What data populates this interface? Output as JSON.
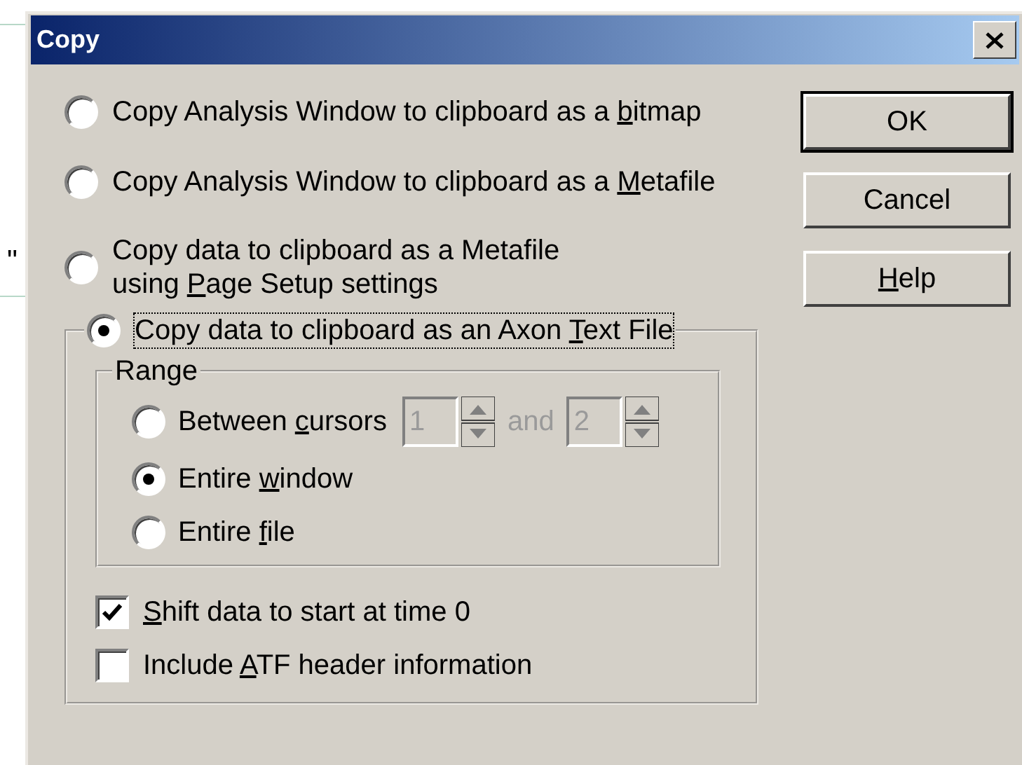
{
  "background": {
    "text_fragment": "\""
  },
  "window": {
    "title": "Copy"
  },
  "options": [
    {
      "selected": false,
      "focused": false,
      "label": [
        {
          "text": "Copy Analysis Window to clipboard as a ",
          "access_key": false
        },
        {
          "text": "b",
          "access_key": true
        },
        {
          "text": "itmap",
          "access_key": false
        }
      ]
    },
    {
      "selected": false,
      "focused": false,
      "label": [
        {
          "text": "Copy Analysis Window to clipboard as a ",
          "access_key": false
        },
        {
          "text": "M",
          "access_key": true
        },
        {
          "text": "etafile",
          "access_key": false
        }
      ]
    },
    {
      "selected": false,
      "focused": false,
      "label": [
        {
          "text": "Copy data to clipboard as a Metafile\nusing ",
          "access_key": false
        },
        {
          "text": "P",
          "access_key": true
        },
        {
          "text": "age Setup settings",
          "access_key": false
        }
      ]
    },
    {
      "selected": true,
      "focused": true,
      "label": [
        {
          "text": "Copy data to clipboard as an Axon ",
          "access_key": false
        },
        {
          "text": "T",
          "access_key": true
        },
        {
          "text": "ext File",
          "access_key": false
        }
      ]
    }
  ],
  "range": {
    "title": "Range",
    "options": [
      {
        "kind": "cursors",
        "selected": false,
        "disabled": true,
        "label": [
          {
            "text": "Between ",
            "access_key": false
          },
          {
            "text": "c",
            "access_key": true
          },
          {
            "text": "ursors",
            "access_key": false
          }
        ],
        "from": "1",
        "joiner": "and",
        "to": "2"
      },
      {
        "kind": "plain",
        "selected": true,
        "label": [
          {
            "text": "Entire ",
            "access_key": false
          },
          {
            "text": "w",
            "access_key": true
          },
          {
            "text": "indow",
            "access_key": false
          }
        ]
      },
      {
        "kind": "plain",
        "selected": false,
        "label": [
          {
            "text": "Entire ",
            "access_key": false
          },
          {
            "text": "f",
            "access_key": true
          },
          {
            "text": "ile",
            "access_key": false
          }
        ]
      }
    ]
  },
  "checkboxes": [
    {
      "checked": true,
      "label": [
        {
          "text": "S",
          "access_key": true
        },
        {
          "text": "hift data to start at time 0",
          "access_key": false
        }
      ]
    },
    {
      "checked": false,
      "label": [
        {
          "text": "Include ",
          "access_key": false
        },
        {
          "text": "A",
          "access_key": true
        },
        {
          "text": "TF header information",
          "access_key": false
        }
      ]
    }
  ],
  "buttons": [
    {
      "default": true,
      "label": [
        {
          "text": "OK",
          "access_key": false
        }
      ]
    },
    {
      "default": false,
      "label": [
        {
          "text": "Cancel",
          "access_key": false
        }
      ]
    },
    {
      "default": false,
      "label": [
        {
          "text": "H",
          "access_key": true
        },
        {
          "text": "elp",
          "access_key": false
        }
      ]
    }
  ]
}
